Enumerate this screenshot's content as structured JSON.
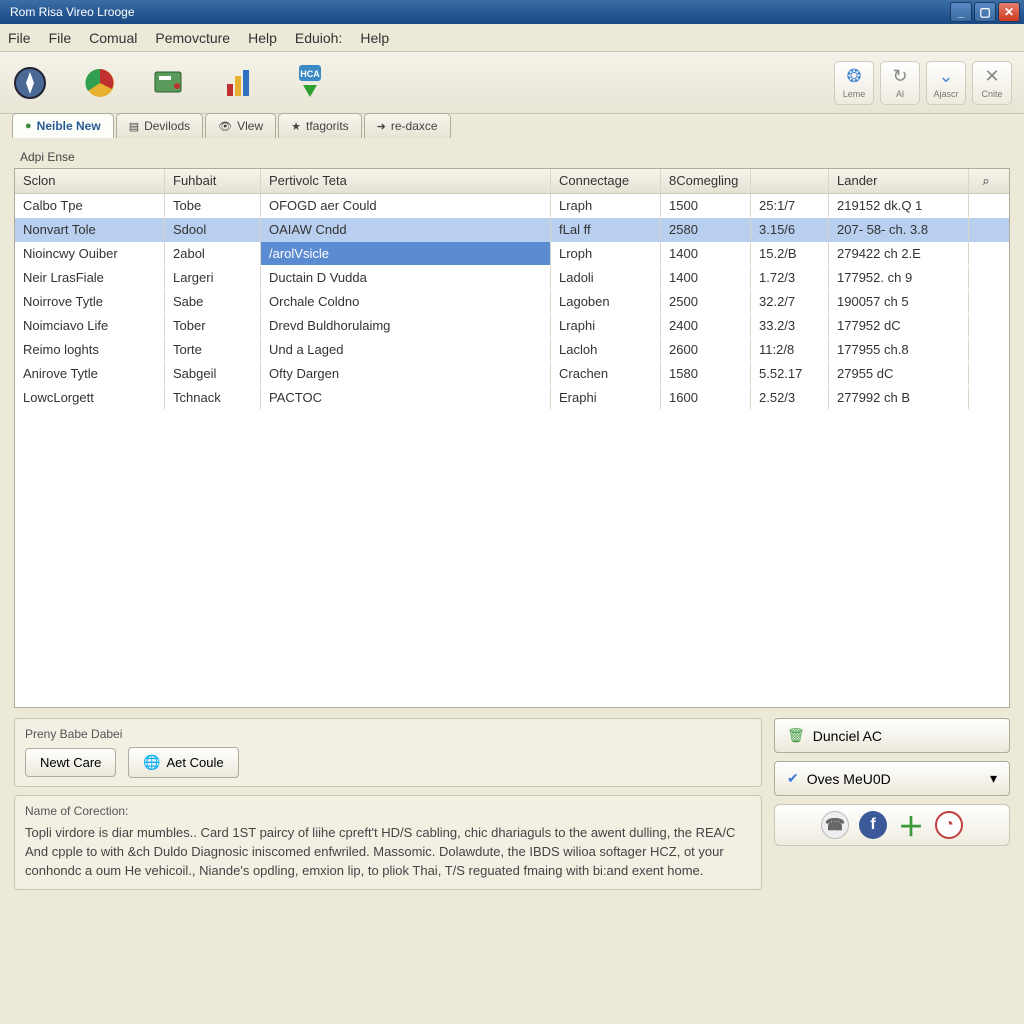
{
  "window": {
    "title": "Rom Risa Vireo Lrooge"
  },
  "menu": {
    "items": [
      "File",
      "File",
      "Comual",
      "Pemovcture",
      "Help",
      "Eduioh:",
      "Help"
    ]
  },
  "toolbar_right": [
    {
      "icon": "⚙",
      "label": "Leme"
    },
    {
      "icon": "↻",
      "label": "Al"
    },
    {
      "icon": "⌄",
      "label": "Ajascr"
    },
    {
      "icon": "✕",
      "label": "Cnite"
    }
  ],
  "tabs": [
    {
      "label": "Neible New",
      "active": true
    },
    {
      "label": "Devilods"
    },
    {
      "label": "Vlew"
    },
    {
      "label": "tfagorits"
    },
    {
      "label": "re-daxce"
    }
  ],
  "group_label": "Adpi Ense",
  "columns": [
    "Sclon",
    "Fuhbait",
    "Pertivolc Teta",
    "Connectage",
    "8Comegling",
    "",
    "Lander"
  ],
  "search_icon": "⌕",
  "rows": [
    {
      "c": [
        "Calbo Tpe",
        "Tobe",
        "OFOGD aer Could",
        "Lraph",
        "1500",
        "25:1/7",
        "219152 dk.Q 1"
      ],
      "sel": false
    },
    {
      "c": [
        "Nonvart Tole",
        "Sdool",
        "OAIAW Cndd",
        "fLal ff",
        "2580",
        "3.15/6",
        "207- 58- ch. 3.8"
      ],
      "sel": true
    },
    {
      "c": [
        "Nioincwy Ouiber",
        "2abol",
        "/arolVsicle",
        "Lroph",
        "1400",
        "15.2/B",
        "279422 ch 2.E"
      ],
      "sel": false,
      "cellsel": 2
    },
    {
      "c": [
        "Neir LrasFiale",
        "Largeri",
        "Ductain D Vudda",
        "Ladoli",
        "1400",
        "1.72/3",
        "177952. ch 9"
      ],
      "sel": false
    },
    {
      "c": [
        "Noirrove Tytle",
        "Sabe",
        "Orchale Coldno",
        "Lagoben",
        "2500",
        "32.2/7",
        "190057 ch 5"
      ],
      "sel": false
    },
    {
      "c": [
        "Noimciavo Life",
        "Tober",
        "Drevd Buldhorulaimg",
        "Lraphi",
        "2400",
        "33.2/3",
        "177952 dC"
      ],
      "sel": false
    },
    {
      "c": [
        "Reimo loghts",
        "Torte",
        "Und a Laged",
        "Lacloh",
        "2600",
        "11:2/8",
        "177955 ch.8"
      ],
      "sel": false
    },
    {
      "c": [
        "Anirove Tytle",
        "Sabgeil",
        "Ofty Dargen",
        "Crachen",
        "1580",
        "5.52.17",
        "27955 dC"
      ],
      "sel": false
    },
    {
      "c": [
        "LowcLorgett",
        "Tchnack",
        "PACTOC",
        "Eraphi",
        "1600",
        "2.52/3",
        "277992 ch B"
      ],
      "sel": false
    }
  ],
  "bottom": {
    "panel1_title": "Preny Babe Dabei",
    "btn_new": "Newt Care",
    "btn_aet": "Aet Coule",
    "panel2_title": "Name of Corection:",
    "desc": "Topli virdore is diar mumbles.. Card 1ST paircy of liihe cpreft't HD/S cabling, chic dhariaguls to the awent dulling, the REA/C And cpple to with &ch Duldo Diagnosic iniscomed enfwriled. Massomic. Dolawdute, the IBDS wilioa softager HCZ, ot your conhondc a oum He vehicoil., Niande's opdling, emxion lip, to pliok Thai, T/S reguated fmaing with bi:and exent home.",
    "btn_dunciel": "Dunciel AC",
    "btn_oves": "Oves MeU0D"
  },
  "colors": {
    "accent": "#2a5a95",
    "row_sel": "#b9cfef",
    "cell_sel": "#5b8bd0"
  }
}
